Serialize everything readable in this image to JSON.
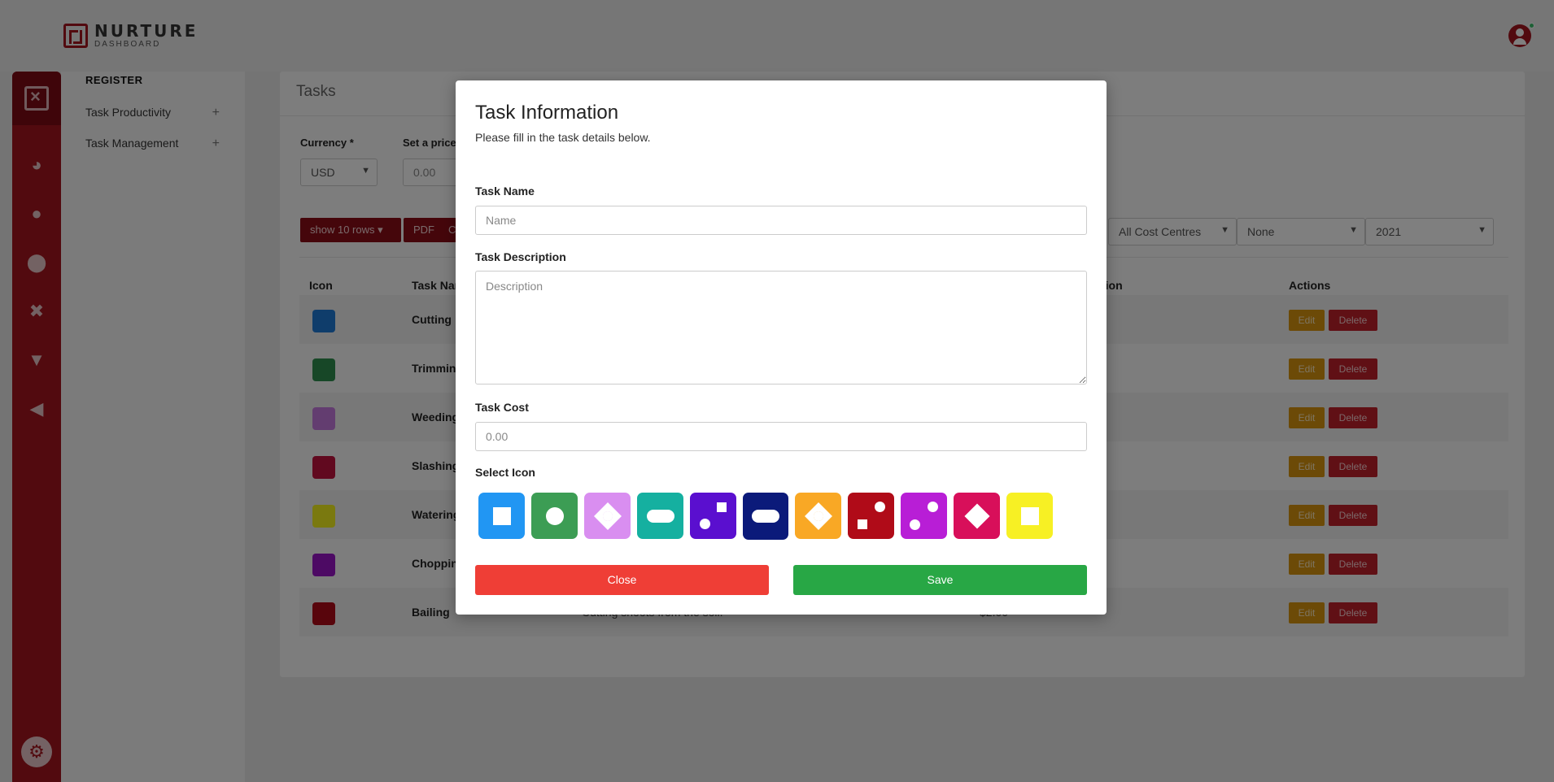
{
  "brand": {
    "title": "NURTURE",
    "subtitle": "DASHBOARD",
    "accent": "#a5141e"
  },
  "subnav": {
    "heading": "REGISTER",
    "items": [
      {
        "label": "Task Productivity"
      },
      {
        "label": "Task Management"
      }
    ]
  },
  "page": {
    "title": "Tasks",
    "currency_label": "Currency *",
    "currency_value": "USD",
    "price_label": "Set a price",
    "price_placeholder": "0.00",
    "show_rows": "show 10 rows",
    "pdf_label": "PDF",
    "csv_label": "CSV",
    "filter_cost_centre": "All Cost Centres",
    "filter_none": "None",
    "filter_year": "2021",
    "columns": {
      "icon": "Icon",
      "name": "Task Name",
      "description": "Description",
      "actions": "Actions"
    },
    "edit_label": "Edit",
    "delete_label": "Delete",
    "rows": [
      {
        "name": "Cutting",
        "desc": "",
        "cost": "",
        "color": "#1e7ad6"
      },
      {
        "name": "Trimming",
        "desc": "",
        "cost": "",
        "color": "#2f8f4e"
      },
      {
        "name": "Weeding",
        "desc": "",
        "cost": "",
        "color": "#c77be0"
      },
      {
        "name": "Slashing",
        "desc": "",
        "cost": "",
        "color": "#c2123f"
      },
      {
        "name": "Watering",
        "desc": "",
        "cost": "",
        "color": "#f4f21e"
      },
      {
        "name": "Chopping",
        "desc": "",
        "cost": "",
        "color": "#9b15c9"
      },
      {
        "name": "Bailing",
        "desc": "Cutting shoots from the soil.",
        "cost": "$2.00",
        "color": "#b00b18"
      }
    ]
  },
  "modal": {
    "title": "Task Information",
    "subtitle": "Please fill in the task details below.",
    "name_label": "Task Name",
    "name_placeholder": "Name",
    "description_label": "Task Description",
    "description_placeholder": "Description",
    "cost_label": "Task Cost",
    "cost_placeholder": "0.00",
    "icon_label": "Select Icon",
    "icons": [
      {
        "name": "square",
        "color": "#2196f3"
      },
      {
        "name": "circle",
        "color": "#3c9d54"
      },
      {
        "name": "diamond-ring",
        "color": "#d98ef0"
      },
      {
        "name": "pill",
        "color": "#15b0a0"
      },
      {
        "name": "square-dot",
        "color": "#5a0fcf"
      },
      {
        "name": "pill",
        "color": "#0b1a7a",
        "selected": true
      },
      {
        "name": "diamond-ring",
        "color": "#f9a825"
      },
      {
        "name": "dot-square",
        "color": "#b00b18"
      },
      {
        "name": "two-dots",
        "color": "#b81ed6"
      },
      {
        "name": "diamond",
        "color": "#d80f5a"
      },
      {
        "name": "square",
        "color": "#f7f024"
      }
    ],
    "close_label": "Close",
    "save_label": "Save"
  }
}
